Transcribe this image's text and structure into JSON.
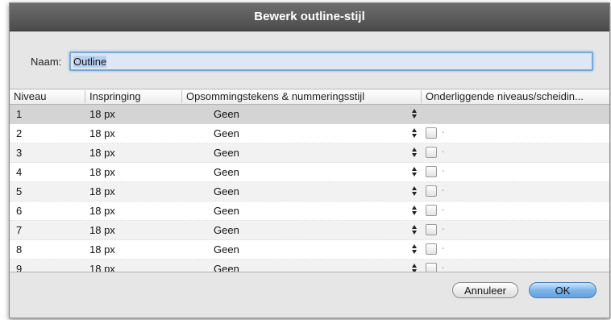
{
  "dialog": {
    "title": "Bewerk outline-stijl"
  },
  "name_field": {
    "label": "Naam:",
    "value": "Outline"
  },
  "table": {
    "columns": [
      "Niveau",
      "Inspringing",
      "Opsommingstekens & nummeringsstijl",
      "Onderliggende niveaus/scheidin..."
    ],
    "rows": [
      {
        "level": "1",
        "indent": "18 px",
        "style": "Geen",
        "has_checkbox": false
      },
      {
        "level": "2",
        "indent": "18 px",
        "style": "Geen",
        "has_checkbox": true
      },
      {
        "level": "3",
        "indent": "18 px",
        "style": "Geen",
        "has_checkbox": true
      },
      {
        "level": "4",
        "indent": "18 px",
        "style": "Geen",
        "has_checkbox": true
      },
      {
        "level": "5",
        "indent": "18 px",
        "style": "Geen",
        "has_checkbox": true
      },
      {
        "level": "6",
        "indent": "18 px",
        "style": "Geen",
        "has_checkbox": true
      },
      {
        "level": "7",
        "indent": "18 px",
        "style": "Geen",
        "has_checkbox": true
      },
      {
        "level": "8",
        "indent": "18 px",
        "style": "Geen",
        "has_checkbox": true
      },
      {
        "level": "9",
        "indent": "18 px",
        "style": "Geen",
        "has_checkbox": true
      }
    ],
    "separator_glyph": "-"
  },
  "buttons": {
    "cancel": "Annuleer",
    "ok": "OK"
  },
  "colors": {
    "titlebar": "#4b4b4b",
    "dialog_bg": "#e6e6e6",
    "selected_row": "#d4d4d4",
    "ok_button": "#7fb6ea",
    "focus_ring": "#79a8d8"
  },
  "icons": {
    "stepper": "up-down-stepper-icon",
    "checkbox": "checkbox-icon"
  }
}
